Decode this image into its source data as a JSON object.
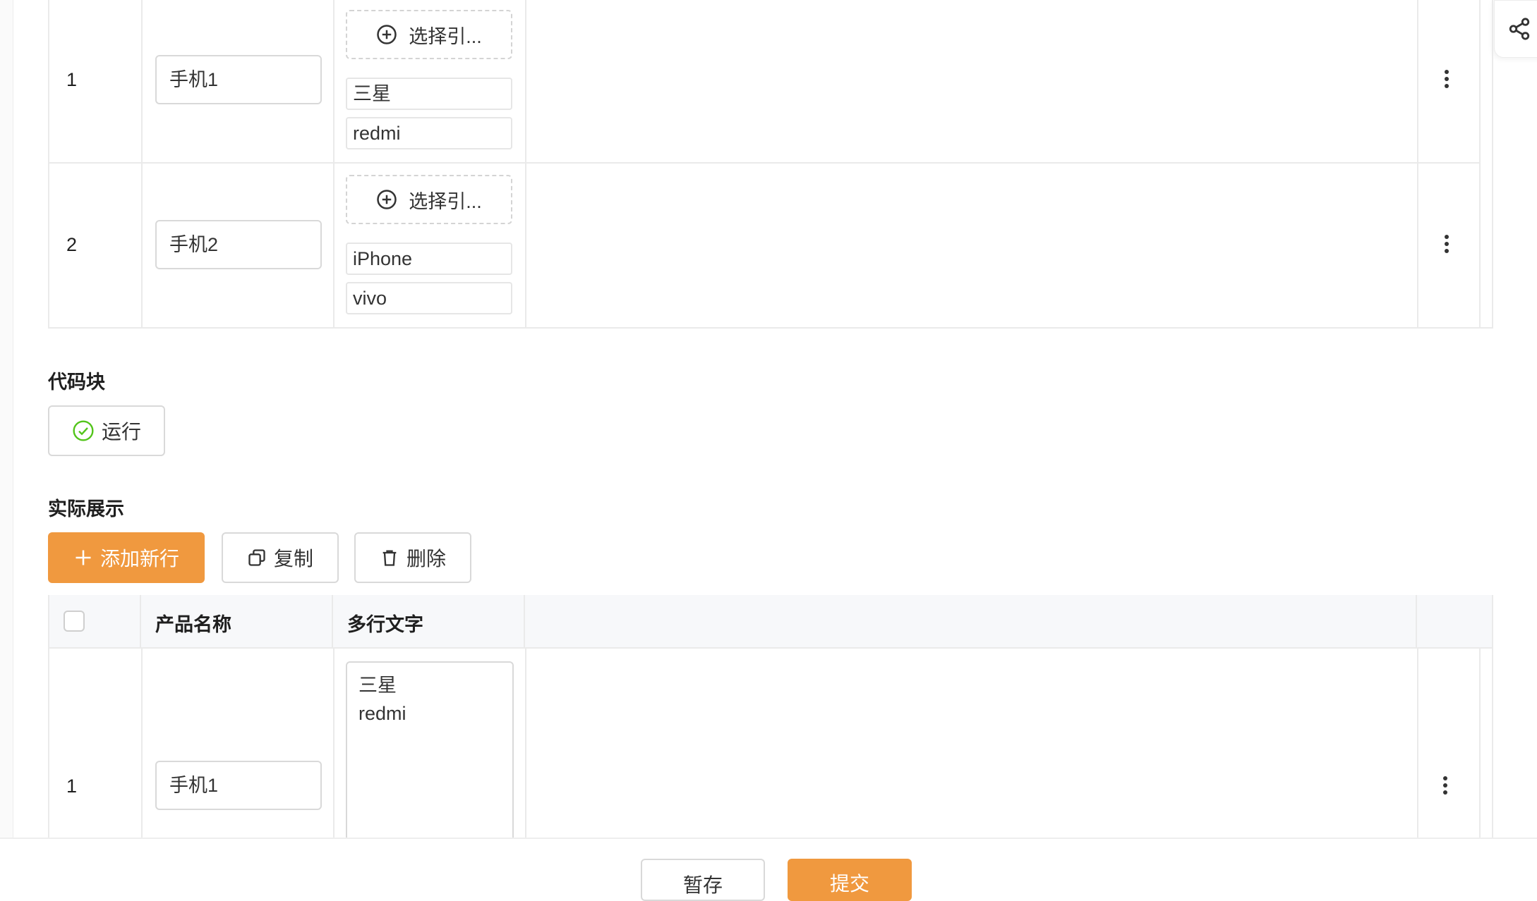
{
  "top_table": {
    "rows": [
      {
        "index": "1",
        "name": "手机1",
        "pick_label": "选择引...",
        "tags": [
          "三星",
          "redmi"
        ]
      },
      {
        "index": "2",
        "name": "手机2",
        "pick_label": "选择引...",
        "tags": [
          "iPhone",
          "vivo"
        ]
      }
    ]
  },
  "code_block": {
    "title": "代码块",
    "run_label": "运行"
  },
  "display": {
    "title": "实际展示",
    "add_row_label": "添加新行",
    "copy_label": "复制",
    "delete_label": "删除",
    "columns": [
      "产品名称",
      "多行文字"
    ],
    "rows": [
      {
        "index": "1",
        "name": "手机1",
        "multiline": "三星\nredmi"
      }
    ]
  },
  "footer": {
    "save_draft_label": "暂存",
    "submit_label": "提交"
  },
  "colors": {
    "primary": "#f0993f",
    "success": "#52c41a",
    "border": "#d9d9d9"
  },
  "icons": [
    "share-icon",
    "plus-circle-icon",
    "more-vertical-icon",
    "check-circle-icon",
    "plus-icon",
    "copy-icon",
    "trash-icon"
  ]
}
